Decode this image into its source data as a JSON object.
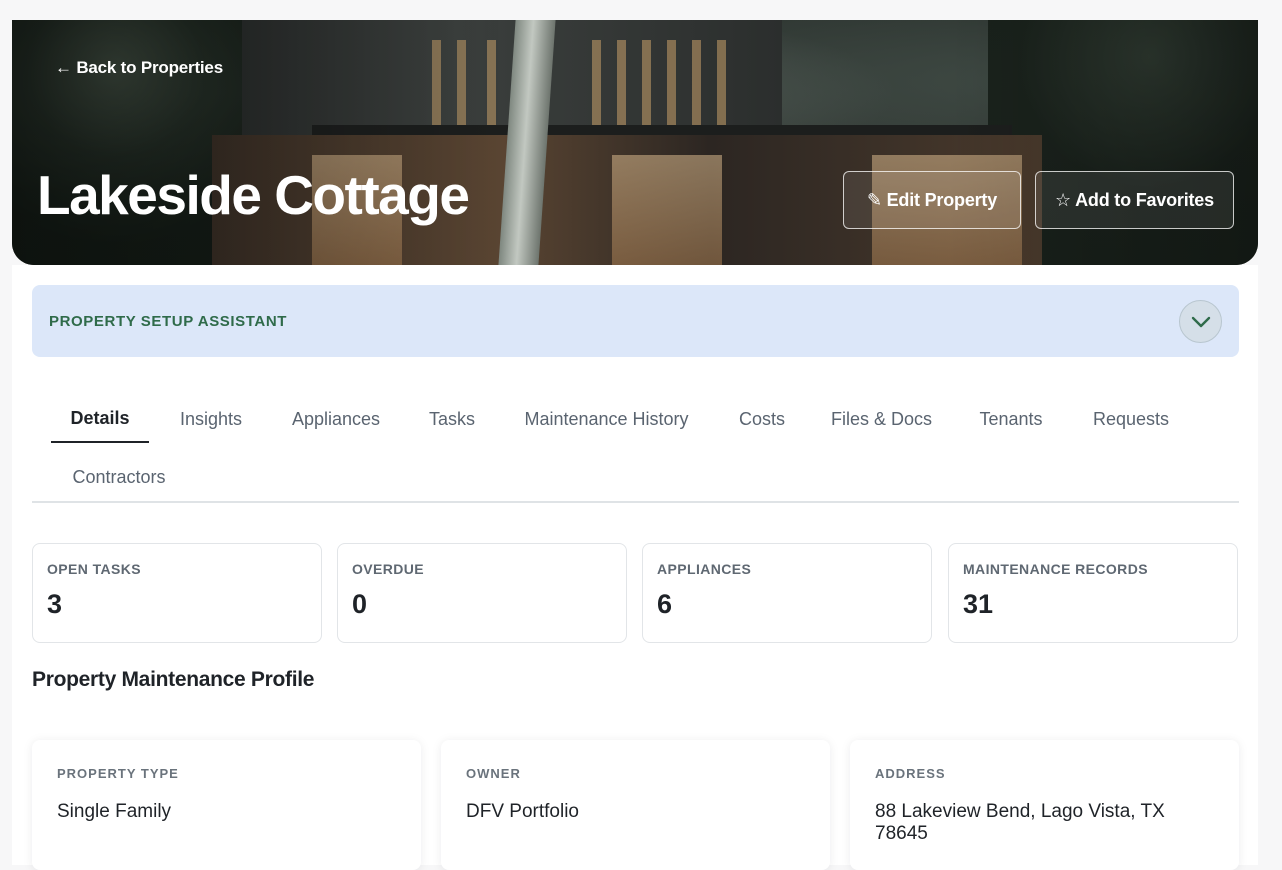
{
  "hero": {
    "back_label": "← Back to Properties",
    "title": "Lakeside Cottage",
    "edit_label": "✎ Edit Property",
    "favorite_label": "☆ Add to Favorites"
  },
  "assistant": {
    "label": "PROPERTY SETUP ASSISTANT",
    "toggle_icon": "chevron-down-icon"
  },
  "tabs": [
    {
      "label": "Details",
      "active": true
    },
    {
      "label": "Insights"
    },
    {
      "label": "Appliances"
    },
    {
      "label": "Tasks"
    },
    {
      "label": "Maintenance History"
    },
    {
      "label": "Costs"
    },
    {
      "label": "Files & Docs"
    },
    {
      "label": "Tenants"
    },
    {
      "label": "Requests"
    },
    {
      "label": "Contractors"
    }
  ],
  "stats": [
    {
      "label": "OPEN TASKS",
      "value": "3"
    },
    {
      "label": "OVERDUE",
      "value": "0"
    },
    {
      "label": "APPLIANCES",
      "value": "6"
    },
    {
      "label": "MAINTENANCE RECORDS",
      "value": "31"
    }
  ],
  "profile": {
    "title": "Property Maintenance Profile",
    "cards": [
      {
        "label": "PROPERTY TYPE",
        "value": "Single Family"
      },
      {
        "label": "OWNER",
        "value": "DFV Portfolio"
      },
      {
        "label": "ADDRESS",
        "value": "88 Lakeview Bend, Lago Vista, TX 78645"
      }
    ]
  },
  "colors": {
    "assistant_bg": "#dce7f9",
    "assistant_text": "#2f6b4a",
    "active_tab": "#1f2328"
  }
}
